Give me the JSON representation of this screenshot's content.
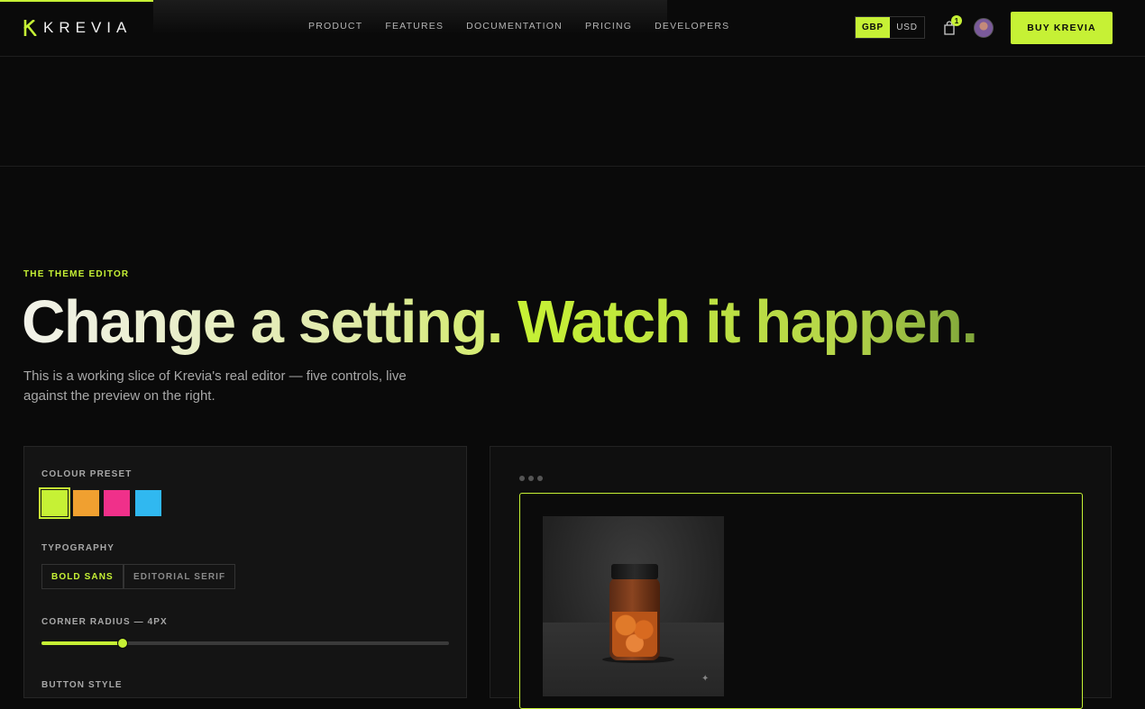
{
  "brand": {
    "name": "KREVIA"
  },
  "nav": {
    "items": [
      "PRODUCT",
      "FEATURES",
      "DOCUMENTATION",
      "PRICING",
      "DEVELOPERS"
    ]
  },
  "header": {
    "currency": {
      "options": [
        "GBP",
        "USD"
      ],
      "selected": "GBP"
    },
    "cart_count": "1",
    "buy_label": "BUY KREVIA"
  },
  "hero": {
    "eyebrow": "THE THEME EDITOR",
    "title_a": "Change a setting.",
    "title_b": "Watch it happen.",
    "lede": "This is a working slice of Krevia's real editor — five controls, live against the preview on the right."
  },
  "editor": {
    "colour_label": "COLOUR PRESET",
    "swatches": [
      "#c6f135",
      "#f0a030",
      "#f0308a",
      "#30b8f0"
    ],
    "selected_swatch": 0,
    "typography_label": "TYPOGRAPHY",
    "typography_options": [
      "BOLD SANS",
      "EDITORIAL SERIF"
    ],
    "typography_selected": "BOLD SANS",
    "radius_label": "CORNER RADIUS — 4PX",
    "radius_fraction": 0.2,
    "button_style_label": "BUTTON STYLE"
  },
  "colors": {
    "accent": "#c6f135",
    "background": "#0a0a0a"
  },
  "icons": [
    "krevia-logo-icon",
    "bag-icon",
    "sparkle-icon"
  ]
}
